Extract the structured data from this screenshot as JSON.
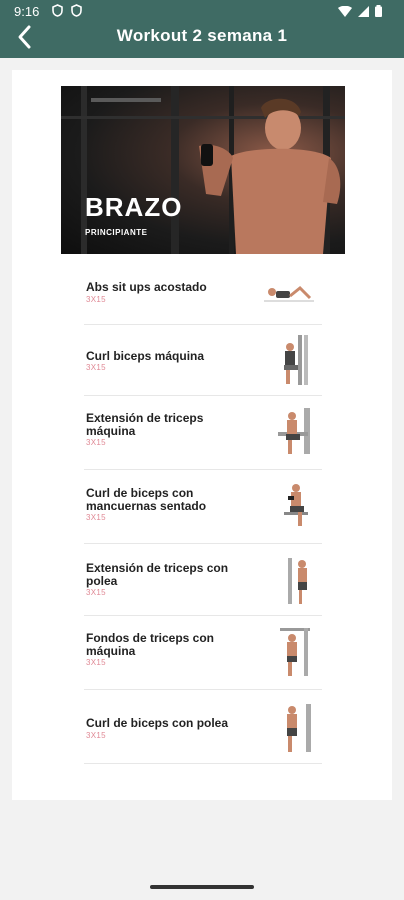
{
  "status_bar": {
    "time": "9:16"
  },
  "app_bar": {
    "title": "Workout 2 semana 1"
  },
  "hero": {
    "title": "BRAZO",
    "level": "PRINCIPIANTE"
  },
  "exercises": [
    {
      "name": "Abs sit ups acostado",
      "sets": "3X15",
      "icon": "sit-up-figure"
    },
    {
      "name": "Curl biceps máquina",
      "sets": "3X15",
      "icon": "biceps-machine-figure"
    },
    {
      "name": "Extensión de triceps máquina",
      "sets": "3X15",
      "icon": "triceps-machine-figure"
    },
    {
      "name": "Curl de biceps con mancuernas sentado",
      "sets": "3X15",
      "icon": "seated-dumbbell-curl-figure"
    },
    {
      "name": "Extensión de triceps con polea",
      "sets": "3X15",
      "icon": "triceps-pulley-figure"
    },
    {
      "name": "Fondos de triceps con máquina",
      "sets": "3X15",
      "icon": "triceps-dip-machine-figure"
    },
    {
      "name": "Curl de biceps con polea",
      "sets": "3X15",
      "icon": "biceps-pulley-figure"
    }
  ],
  "colors": {
    "app_bar": "#3f6b64",
    "sets_text": "#e08a96"
  }
}
